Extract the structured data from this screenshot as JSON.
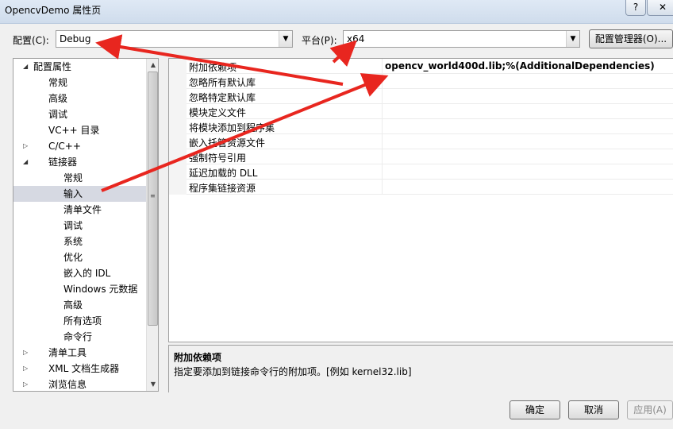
{
  "window": {
    "title": "OpencvDemo 属性页",
    "help_label": "?",
    "close_label": "✕"
  },
  "toolbar": {
    "config_label": "配置(C):",
    "config_value": "Debug",
    "platform_label": "平台(P):",
    "platform_value": "x64",
    "config_manager_label": "配置管理器(O)..."
  },
  "tree": {
    "items": [
      {
        "label": "配置属性",
        "twisty": "◢"
      },
      {
        "label": "常规"
      },
      {
        "label": "高级"
      },
      {
        "label": "调试"
      },
      {
        "label": "VC++ 目录"
      },
      {
        "label": "C/C++",
        "twisty": "▷"
      },
      {
        "label": "链接器",
        "twisty": "◢"
      },
      {
        "label": "常规"
      },
      {
        "label": "输入"
      },
      {
        "label": "清单文件"
      },
      {
        "label": "调试"
      },
      {
        "label": "系统"
      },
      {
        "label": "优化"
      },
      {
        "label": "嵌入的 IDL"
      },
      {
        "label": "Windows 元数据"
      },
      {
        "label": "高级"
      },
      {
        "label": "所有选项"
      },
      {
        "label": "命令行"
      },
      {
        "label": "清单工具",
        "twisty": "▷"
      },
      {
        "label": "XML 文档生成器",
        "twisty": "▷"
      },
      {
        "label": "浏览信息",
        "twisty": "▷"
      }
    ]
  },
  "grid": {
    "rows": [
      {
        "name": "附加依赖项",
        "value": "opencv_world400d.lib;%(AdditionalDependencies)"
      },
      {
        "name": "忽略所有默认库",
        "value": ""
      },
      {
        "name": "忽略特定默认库",
        "value": ""
      },
      {
        "name": "模块定义文件",
        "value": ""
      },
      {
        "name": "将模块添加到程序集",
        "value": ""
      },
      {
        "name": "嵌入托管资源文件",
        "value": ""
      },
      {
        "name": "强制符号引用",
        "value": ""
      },
      {
        "name": "延迟加载的 DLL",
        "value": ""
      },
      {
        "name": "程序集链接资源",
        "value": ""
      }
    ]
  },
  "description": {
    "title": "附加依赖项",
    "text": "指定要添加到链接命令行的附加项。[例如 kernel32.lib]"
  },
  "buttons": {
    "ok": "确定",
    "cancel": "取消",
    "apply": "应用(A)"
  },
  "colors": {
    "annotation_arrow": "#e8261f",
    "selected_item": "#d6d9e2"
  },
  "icons": {
    "dropdown": "chevron-down-icon",
    "scroll_up": "arrow-up-icon",
    "scroll_down": "arrow-down-icon"
  }
}
